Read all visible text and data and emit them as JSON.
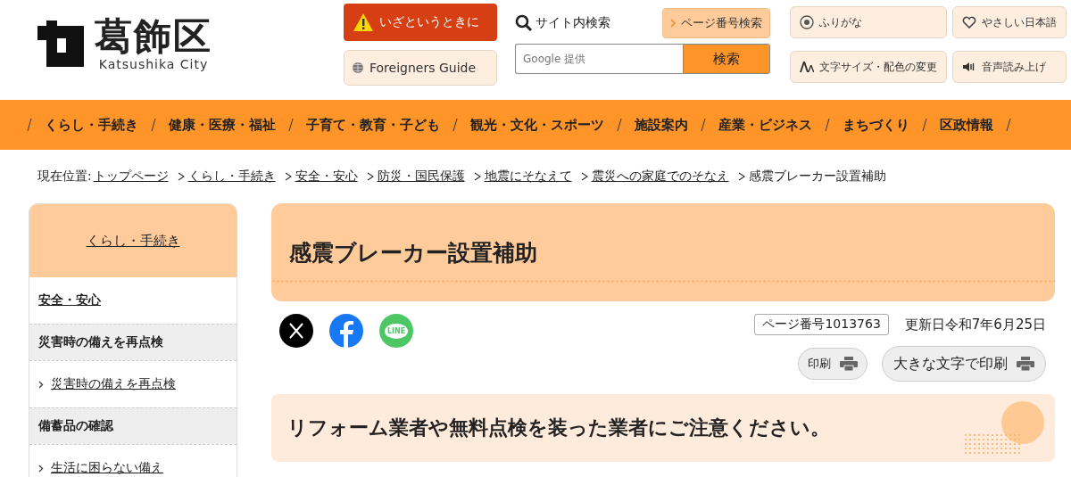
{
  "logo": {
    "name": "葛飾区",
    "subtitle": "Katsushika City"
  },
  "header": {
    "emergency": "いざというときに",
    "foreigners": "Foreigners Guide",
    "site_search_label": "サイト内検索",
    "page_number_search": "ページ番号検索",
    "search": {
      "placeholder": "Google 提供",
      "button": "検索"
    },
    "tools": [
      {
        "kind": "furigana",
        "label": "ふりがな"
      },
      {
        "kind": "easy",
        "label": "やさしい日本語"
      },
      {
        "kind": "textsize",
        "label": "文字サイズ・配色の変更"
      },
      {
        "kind": "speech",
        "label": "音声読み上げ"
      }
    ]
  },
  "nav": [
    "くらし・手続き",
    "健康・医療・福祉",
    "子育て・教育・子ども",
    "観光・文化・スポーツ",
    "施設案内",
    "産業・ビジネス",
    "まちづくり",
    "区政情報"
  ],
  "breadcrumb": {
    "label": "現在位置:",
    "items": [
      {
        "text": "トップページ",
        "link": true
      },
      {
        "text": "くらし・手続き",
        "link": true
      },
      {
        "text": "安全・安心",
        "link": true
      },
      {
        "text": "防災・国民保護",
        "link": true
      },
      {
        "text": "地震にそなえて",
        "link": true
      },
      {
        "text": "震災への家庭でのそなえ",
        "link": true
      },
      {
        "text": "感震ブレーカー設置補助",
        "link": false
      }
    ]
  },
  "sidebar": {
    "title": "くらし・手続き",
    "items": [
      {
        "kind": "section",
        "text": "安全・安心"
      },
      {
        "kind": "heading",
        "text": "災害時の備えを再点検"
      },
      {
        "kind": "link",
        "text": "災害時の備えを再点検"
      },
      {
        "kind": "heading",
        "text": "備蓄品の確認"
      },
      {
        "kind": "link",
        "text": "生活に困らない備え"
      }
    ]
  },
  "main": {
    "title": "感震ブレーカー設置補助",
    "share": [
      {
        "kind": "x"
      },
      {
        "kind": "facebook"
      },
      {
        "kind": "line",
        "label": "LINE"
      }
    ],
    "page_number": "ページ番号1013763",
    "updated": "更新日令和7年6月25日",
    "print": "印刷",
    "print_large": "大きな文字で印刷",
    "notice": "リフォーム業者や無料点検を装った業者にご注意ください。"
  }
}
